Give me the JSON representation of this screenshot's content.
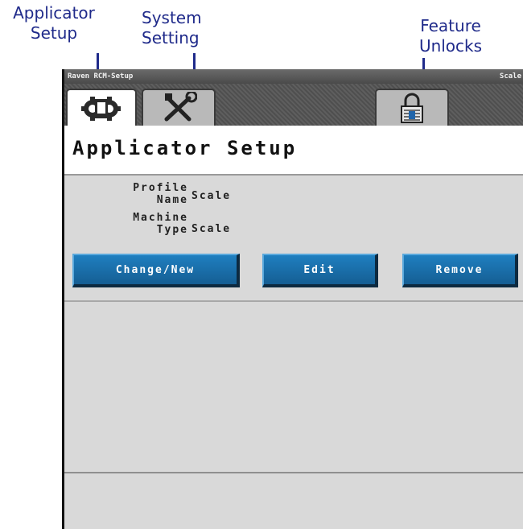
{
  "callouts": {
    "applicator": [
      "Applicator",
      "Setup"
    ],
    "system": [
      "System",
      "Setting"
    ],
    "feature": [
      "Feature",
      "Unlocks"
    ]
  },
  "titlebar": {
    "left": "Raven RCM-Setup",
    "right": "Scale"
  },
  "tabs": [
    {
      "name": "applicator-setup",
      "icon": "gear-wrench-icon",
      "selected": true
    },
    {
      "name": "system-setting",
      "icon": "tools-icon",
      "selected": false
    },
    {
      "name": "feature-unlocks",
      "icon": "padlock-icon",
      "selected": false
    }
  ],
  "page": {
    "title": "Applicator Setup",
    "fields": [
      {
        "label": [
          "Profile",
          "Name"
        ],
        "value": "Scale"
      },
      {
        "label": [
          "Machine",
          "Type"
        ],
        "value": "Scale"
      }
    ]
  },
  "buttons": {
    "change_new": "Change/New",
    "edit": "Edit",
    "remove": "Remove"
  },
  "colors": {
    "button": "#1a6fa9",
    "callout": "#1f2a8a"
  }
}
